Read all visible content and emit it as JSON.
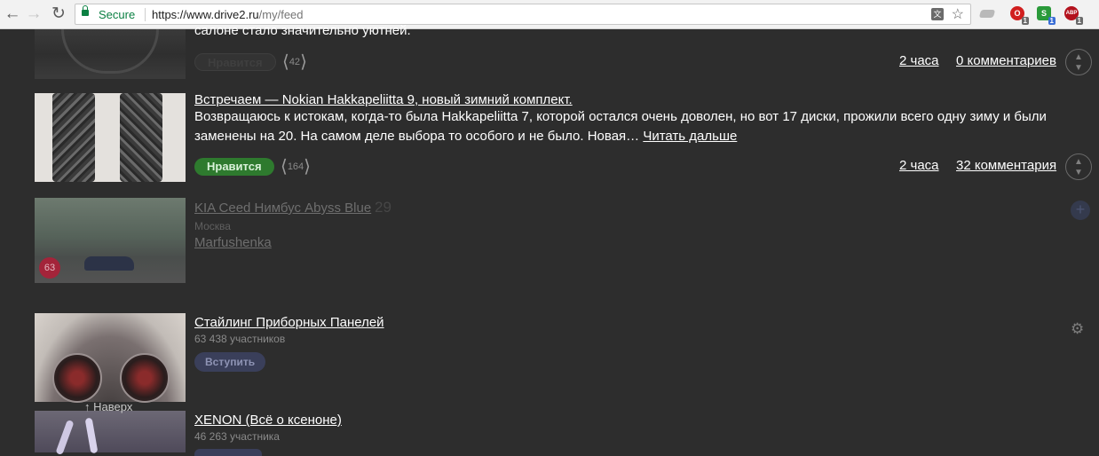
{
  "browser": {
    "secure_label": "Secure",
    "url_base": "https://www.drive2.ru",
    "url_path": "/my/feed",
    "extensions": [
      {
        "name": "opera-ext",
        "badge": "1",
        "color": "#d11f1f",
        "glyph": "O"
      },
      {
        "name": "s-ext",
        "badge": "1",
        "color": "#2a9a3a",
        "glyph": "S"
      },
      {
        "name": "adblock-ext",
        "badge": "1",
        "color": "#b3121d",
        "glyph": "ABP"
      }
    ]
  },
  "posts": [
    {
      "excerpt_tail": "салоне стало значительно уютней.",
      "like_label": "Нравится",
      "like_count": "42",
      "time": "2 часа",
      "comments": "0 комментариев"
    },
    {
      "title": "Встречаем — Nokian Hakkapeliitta 9, новый зимний комплект.",
      "excerpt_line1": "Возвращаюсь к истокам, когда-то была Hakkapeliitta 7, которой остался очень доволен, но вот 17 диски, прожили всего одну зиму и были",
      "excerpt_line2": "заменены на 20. На самом деле выбора то особого и не было. Новая…",
      "read_more": "Читать дальше",
      "like_label": "Нравится",
      "like_count": "164",
      "time": "2 часа",
      "comments": "32 комментария"
    }
  ],
  "car": {
    "name": "KIA Ceed Нимбус Abyss Blue",
    "number": "29",
    "city": "Москва",
    "owner": "Marfushenka",
    "badge": "63"
  },
  "communities": [
    {
      "name": "Стайлинг Приборных Панелей",
      "members": "63 438 участников",
      "join_label": "Вступить"
    },
    {
      "name": "XENON (Всё о ксеноне)",
      "members": "46 263 участника"
    }
  ],
  "scroll_top_label": "Наверх"
}
